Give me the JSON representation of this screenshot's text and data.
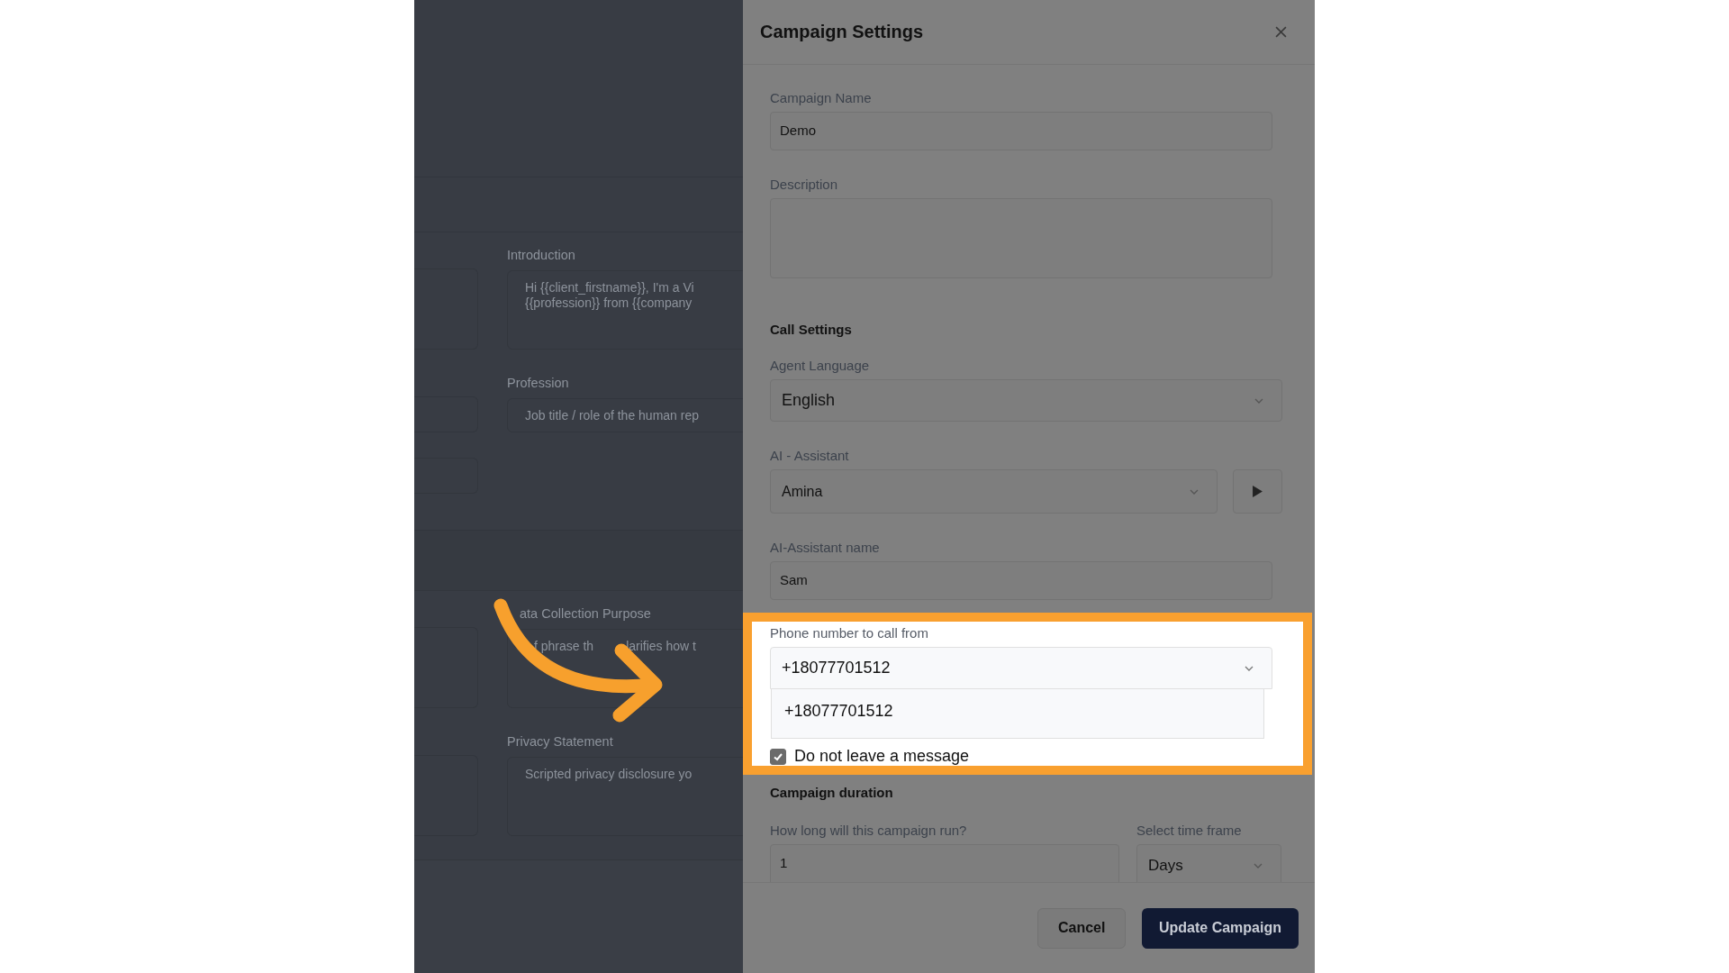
{
  "background_page": {
    "fields": [
      {
        "kind": "textarea",
        "label": "Introduction",
        "covered": false,
        "lines": [
          [
            "Hi {{client_firstname}}, I'm a Vi"
          ],
          [
            "{{profession}} from {{company"
          ]
        ]
      },
      {
        "kind": "input",
        "label": "Profession",
        "covered": false,
        "placeholder": "Job title / role of the human rep"
      },
      {
        "kind": "textarea",
        "label": "ata Collection Purpose",
        "covered": true,
        "lines": [
          [
            "f phrase th",
            "larifies how t"
          ]
        ]
      },
      {
        "kind": "textarea",
        "label": "Privacy Statement",
        "covered": false,
        "lines": [
          [
            "Scripted privacy disclosure yo"
          ]
        ]
      }
    ]
  },
  "modal": {
    "title": "Campaign Settings",
    "fields": [
      {
        "kind": "text",
        "label": "Campaign Name",
        "value": "Demo"
      },
      {
        "kind": "textarea",
        "label": "Description"
      },
      {
        "kind": "heading",
        "label": "Call Settings"
      },
      {
        "kind": "select",
        "label": "Agent Language",
        "value": "English"
      },
      {
        "kind": "select_play",
        "label": "AI - Assistant",
        "value": "Amina"
      },
      {
        "kind": "text",
        "label": "AI-Assistant name",
        "value": "Sam"
      }
    ],
    "highlight": {
      "label": "Phone number to call from",
      "value": "+18077701512",
      "options": [
        "+18077701512"
      ],
      "checkbox": {
        "label": "Do not leave a message",
        "checked": true
      }
    },
    "duration": {
      "heading": "Campaign duration",
      "length_label": "How long will this campaign run?",
      "length_value": "1",
      "timeframe_label": "Select time frame",
      "timeframe_value": "Days"
    },
    "buttons": [
      {
        "label": "Cancel",
        "kind": "secondary"
      },
      {
        "label": "Update Campaign",
        "kind": "primary"
      }
    ]
  }
}
